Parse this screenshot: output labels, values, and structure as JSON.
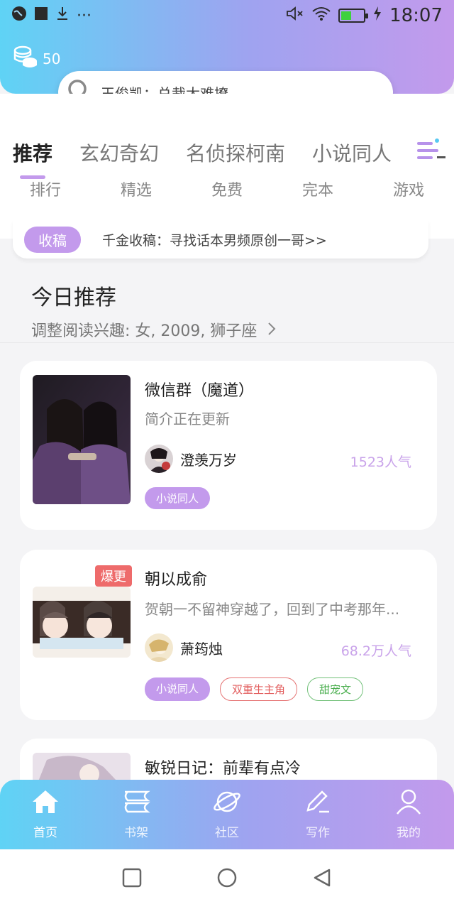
{
  "status_bar": {
    "time": "18:07",
    "battery_level": 0.45,
    "icons": [
      "vpn-globe-icon",
      "app-square-icon",
      "download-icon",
      "more-dots-icon",
      "mute-icon",
      "wifi-icon",
      "battery-icon",
      "charging-icon"
    ]
  },
  "coins": {
    "count": "50"
  },
  "search": {
    "placeholder": "王俊凯：总裁太难撩"
  },
  "tabs": [
    {
      "label": "推荐",
      "active": true
    },
    {
      "label": "玄幻奇幻"
    },
    {
      "label": "名侦探柯南"
    },
    {
      "label": "小说同人"
    }
  ],
  "subtabs": [
    "排行",
    "精选",
    "免费",
    "完本",
    "游戏"
  ],
  "notice": {
    "badge": "收稿",
    "text": "千金收稿：寻找话本男频原创一哥>>"
  },
  "section": {
    "title": "今日推荐",
    "subtitle": "调整阅读兴趣: 女, 2009, 狮子座"
  },
  "books": [
    {
      "title": "微信群（魔道）",
      "description": "简介正在更新",
      "author": "澄羡万岁",
      "popularity": "1523人气",
      "tags": [
        {
          "label": "小说同人",
          "style": "purple"
        }
      ]
    },
    {
      "badge": "爆更",
      "title": "朝以成俞",
      "description": "贺朝一不留神穿越了，回到了中考那年...",
      "author": "萧筠烛",
      "popularity": "68.2万人气",
      "tags": [
        {
          "label": "小说同人",
          "style": "purple"
        },
        {
          "label": "双重生主角",
          "style": "red"
        },
        {
          "label": "甜宠文",
          "style": "green"
        }
      ]
    },
    {
      "title": "敏锐日记：前辈有点冷"
    }
  ],
  "bottom_nav": [
    {
      "label": "首页",
      "icon": "home-icon",
      "active": true
    },
    {
      "label": "书架",
      "icon": "bookshelf-icon"
    },
    {
      "label": "社区",
      "icon": "planet-icon"
    },
    {
      "label": "写作",
      "icon": "pen-icon"
    },
    {
      "label": "我的",
      "icon": "user-icon"
    }
  ],
  "colors": {
    "gradient_start": "#5fd3f5",
    "gradient_end": "#c39aec",
    "accent_purple": "#c39aec",
    "hot_red": "#ee6b6b"
  }
}
